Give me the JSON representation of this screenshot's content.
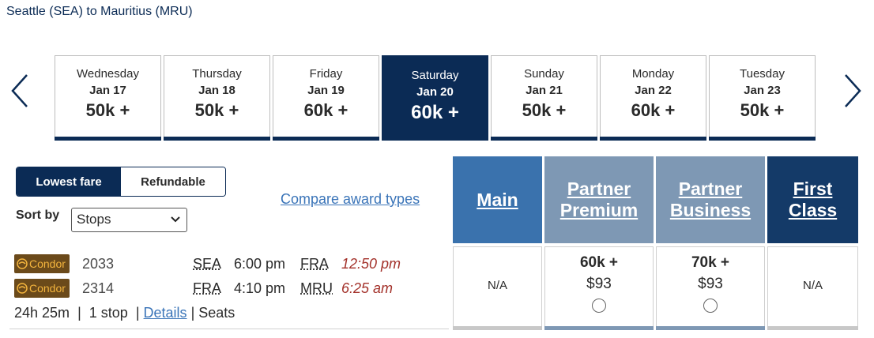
{
  "route_title": "Seattle (SEA) to Mauritius (MRU)",
  "dates": [
    {
      "dow": "Wednesday",
      "date": "Jan 17",
      "price": "50k +"
    },
    {
      "dow": "Thursday",
      "date": "Jan 18",
      "price": "50k +"
    },
    {
      "dow": "Friday",
      "date": "Jan 19",
      "price": "60k +"
    },
    {
      "dow": "Saturday",
      "date": "Jan 20",
      "price": "60k +"
    },
    {
      "dow": "Sunday",
      "date": "Jan 21",
      "price": "50k +"
    },
    {
      "dow": "Monday",
      "date": "Jan 22",
      "price": "60k +"
    },
    {
      "dow": "Tuesday",
      "date": "Jan 23",
      "price": "50k +"
    }
  ],
  "selected_date_index": 3,
  "fare_toggle": {
    "lowest": "Lowest fare",
    "refundable": "Refundable",
    "active": "lowest"
  },
  "sort": {
    "label": "Sort by",
    "value": "Stops"
  },
  "compare_link": "Compare award types",
  "cabins": {
    "main": "Main",
    "partner_premium": "Partner Premium",
    "partner_business": "Partner Business",
    "first": "First Class"
  },
  "flight": {
    "segments": [
      {
        "airline": "Condor",
        "number": "2033",
        "from": "SEA",
        "depart": "6:00 pm",
        "to": "FRA",
        "arrive": "12:50 pm"
      },
      {
        "airline": "Condor",
        "number": "2314",
        "from": "FRA",
        "depart": "4:10 pm",
        "to": "MRU",
        "arrive": "6:25 am"
      }
    ],
    "duration": "24h 25m",
    "stops": "1 stop",
    "details_link": "Details",
    "seats_link": "Seats",
    "fares": {
      "main": "N/A",
      "partner_premium": {
        "miles": "60k +",
        "tax": "$93"
      },
      "partner_business": {
        "miles": "70k +",
        "tax": "$93"
      },
      "first": "N/A"
    }
  },
  "icons": {
    "prev": "chevron-left-icon",
    "next": "chevron-right-icon",
    "airline": "condor-logo-icon",
    "dropdown": "chevron-down-icon"
  },
  "colors": {
    "navy": "#0b2b55",
    "main_cabin": "#3a72ad",
    "partner_cabin": "#7e98b4",
    "first_cabin": "#143a68",
    "link": "#3a74b8",
    "arrival_time": "#a3312a"
  }
}
